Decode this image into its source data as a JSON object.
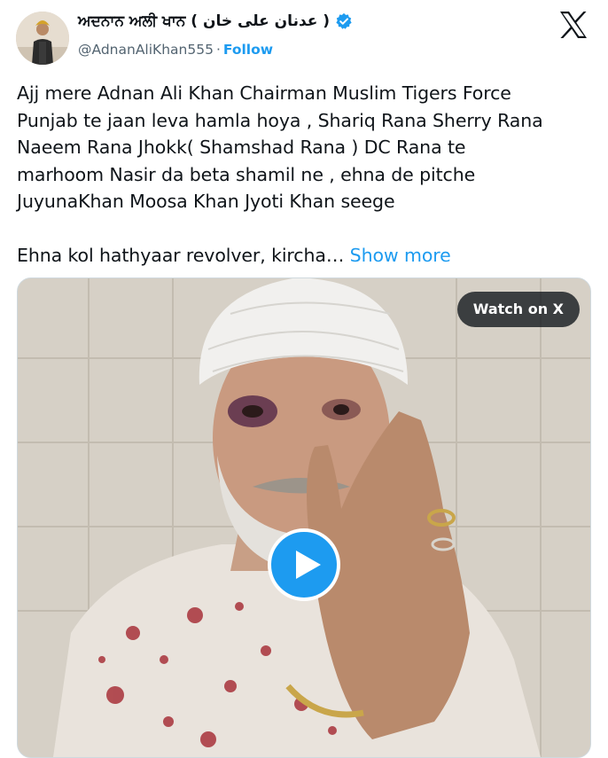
{
  "header": {
    "display_name": "ਅਦਨਾਨ ਅਲੀ ਖਾਨ ( عدنان علی خان )",
    "handle": "@AdnanAliKhan555",
    "separator": "·",
    "follow_label": "Follow",
    "verified_icon": "verified-badge-icon",
    "logo_icon": "x-logo-icon"
  },
  "tweet": {
    "lines": [
      "Ajj mere Adnan Ali Khan Chairman Muslim Tigers Force",
      "Punjab te jaan leva hamla hoya , Shariq Rana Sherry Rana",
      "Naeem Rana Jhokk( Shamshad Rana ) DC Rana te",
      "marhoom Nasir da beta shamil ne , ehna de pitche",
      "JuyunaKhan Moosa Khan Jyoti Khan seege"
    ],
    "last_line": "Ehna kol hathyaar revolver, kircha…",
    "show_more_label": "Show more"
  },
  "media": {
    "watch_label": "Watch on X",
    "play_icon": "play-icon"
  },
  "colors": {
    "accent": "#1d9bf0",
    "text": "#0f1419",
    "secondary": "#536471"
  }
}
